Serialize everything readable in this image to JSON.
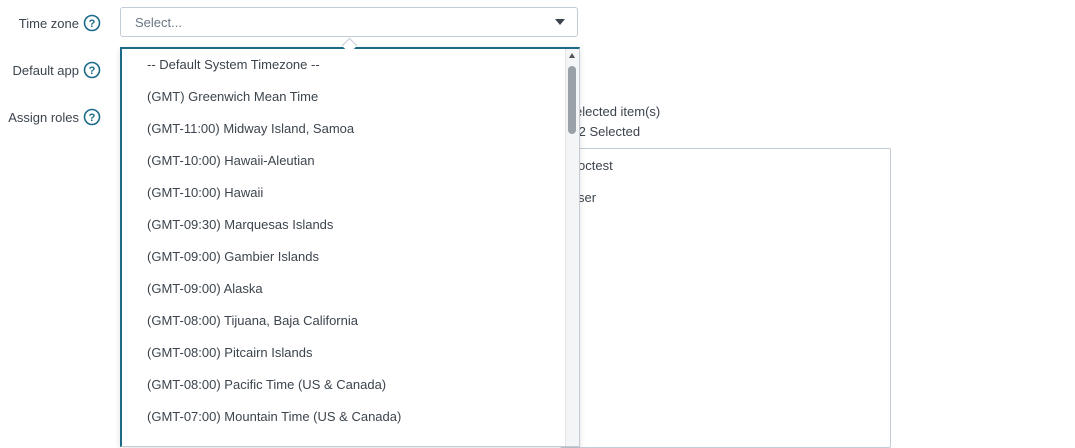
{
  "form": {
    "time_zone_label": "Time zone",
    "default_app_label": "Default app",
    "assign_roles_label": "Assign roles",
    "select_placeholder": "Select..."
  },
  "roles_panel": {
    "selected_items_text": "elected item(s)",
    "selected_count_text": "/2 Selected",
    "roles": [
      "octest",
      "ser"
    ]
  },
  "timezone_options": [
    "-- Default System Timezone --",
    "(GMT) Greenwich Mean Time",
    "(GMT-11:00) Midway Island, Samoa",
    "(GMT-10:00) Hawaii-Aleutian",
    "(GMT-10:00) Hawaii",
    "(GMT-09:30) Marquesas Islands",
    "(GMT-09:00) Gambier Islands",
    "(GMT-09:00) Alaska",
    "(GMT-08:00) Tijuana, Baja California",
    "(GMT-08:00) Pitcairn Islands",
    "(GMT-08:00) Pacific Time (US & Canada)",
    "(GMT-07:00) Mountain Time (US & Canada)"
  ],
  "colors": {
    "accent": "#1a6a88",
    "help_icon": "#1a6a88",
    "border": "#c3cbd4",
    "text": "#3c444d"
  },
  "icons": {
    "help": "question-circle-icon",
    "caret": "chevron-down-icon",
    "scroll_up": "arrow-up-icon"
  }
}
